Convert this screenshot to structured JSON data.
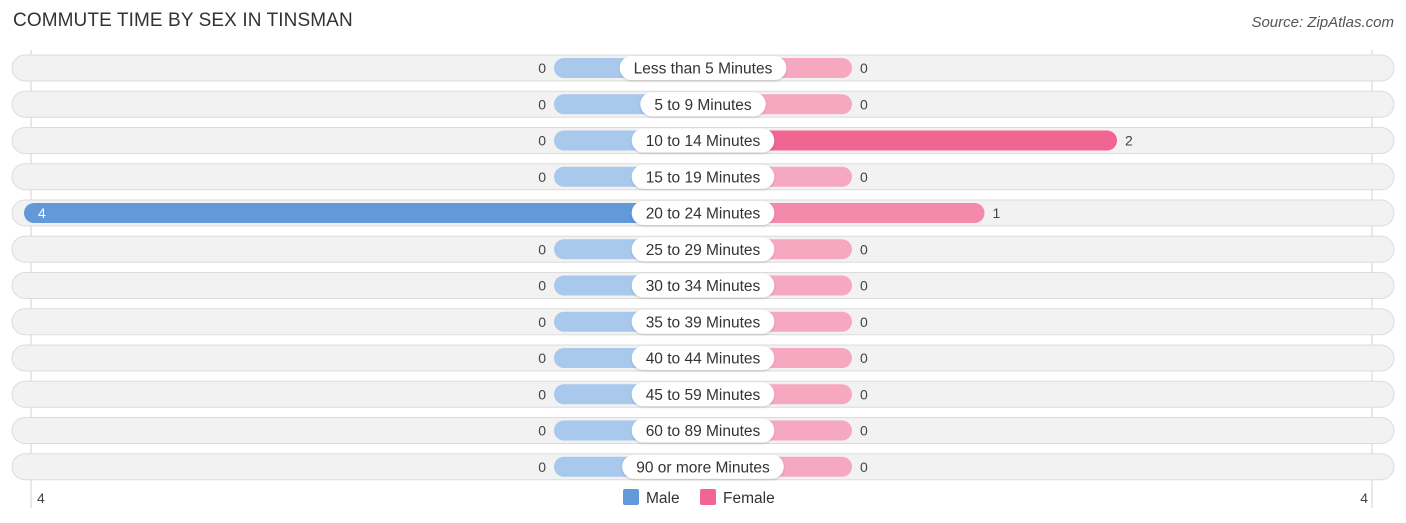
{
  "chart_data": {
    "type": "bar",
    "orientation": "horizontal-diverging",
    "title": "COMMUTE TIME BY SEX IN TINSMAN",
    "source": "Source: ZipAtlas.com",
    "categories": [
      "Less than 5 Minutes",
      "5 to 9 Minutes",
      "10 to 14 Minutes",
      "15 to 19 Minutes",
      "20 to 24 Minutes",
      "25 to 29 Minutes",
      "30 to 34 Minutes",
      "35 to 39 Minutes",
      "40 to 44 Minutes",
      "45 to 59 Minutes",
      "60 to 89 Minutes",
      "90 or more Minutes"
    ],
    "series": [
      {
        "name": "Male",
        "color": "#6199d9",
        "light_color": "#a8c8ec",
        "values": [
          0,
          0,
          0,
          0,
          4,
          0,
          0,
          0,
          0,
          0,
          0,
          0
        ]
      },
      {
        "name": "Female",
        "color": "#f06591",
        "light_color": "#f7a8c1",
        "values": [
          0,
          0,
          2,
          0,
          1,
          0,
          0,
          0,
          0,
          0,
          0,
          0
        ]
      }
    ],
    "xlim": [
      4,
      4
    ],
    "axis_labels": {
      "left": "4",
      "right": "4"
    },
    "legend": {
      "position": "bottom-center",
      "entries": [
        "Male",
        "Female"
      ]
    },
    "grid": false
  }
}
